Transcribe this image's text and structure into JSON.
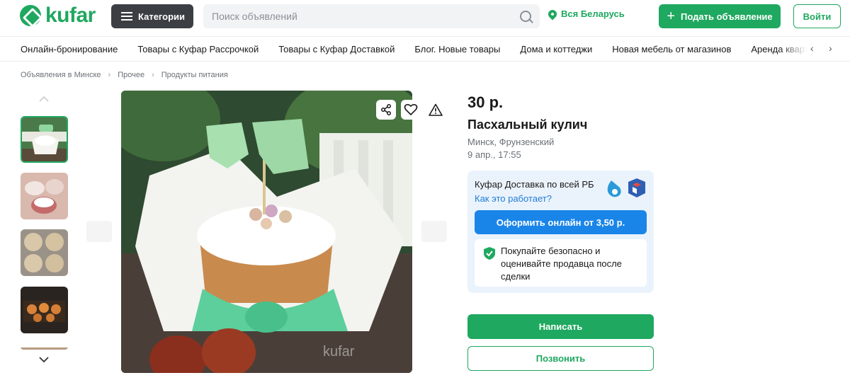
{
  "header": {
    "logo_text": "kufar",
    "categories_label": "Категории",
    "search_placeholder": "Поиск объявлений",
    "region_label": "Вся Беларусь",
    "post_ad_label": "Подать объявление",
    "login_label": "Войти"
  },
  "nav": {
    "items": [
      "Онлайн-бронирование",
      "Товары с Куфар Рассрочкой",
      "Товары с Куфар Доставкой",
      "Блог. Новые товары",
      "Дома и коттеджи",
      "Новая мебель от магазинов",
      "Аренда квартир"
    ]
  },
  "breadcrumbs": [
    "Объявления в Минске",
    "Прочее",
    "Продукты питания"
  ],
  "listing": {
    "price": "30 р.",
    "title": "Пасхальный кулич",
    "location": "Минск, Фрунзенский",
    "date": "9 апр., 17:55",
    "image_watermark": "kufar"
  },
  "delivery": {
    "title": "Куфар Доставка по всей РБ",
    "how_link": "Как это работает?",
    "checkout_label": "Оформить онлайн от 3,50 р.",
    "safe_text": "Покупайте безопасно и оценивайте продавца после сделки"
  },
  "actions": {
    "write_label": "Написать",
    "call_label": "Позвонить"
  },
  "colors": {
    "brand_green": "#1fa85f",
    "accent_blue": "#1a85e8",
    "delivery_bg": "#eaf3fc"
  },
  "icons": [
    "logo-icon",
    "menu-icon",
    "search-icon",
    "location-pin-icon",
    "plus-icon",
    "chevron-left-icon",
    "chevron-right-icon",
    "chevron-up-icon",
    "chevron-down-icon",
    "share-icon",
    "heart-icon",
    "warning-icon",
    "shield-check-icon",
    "delivery-logo-icon"
  ]
}
